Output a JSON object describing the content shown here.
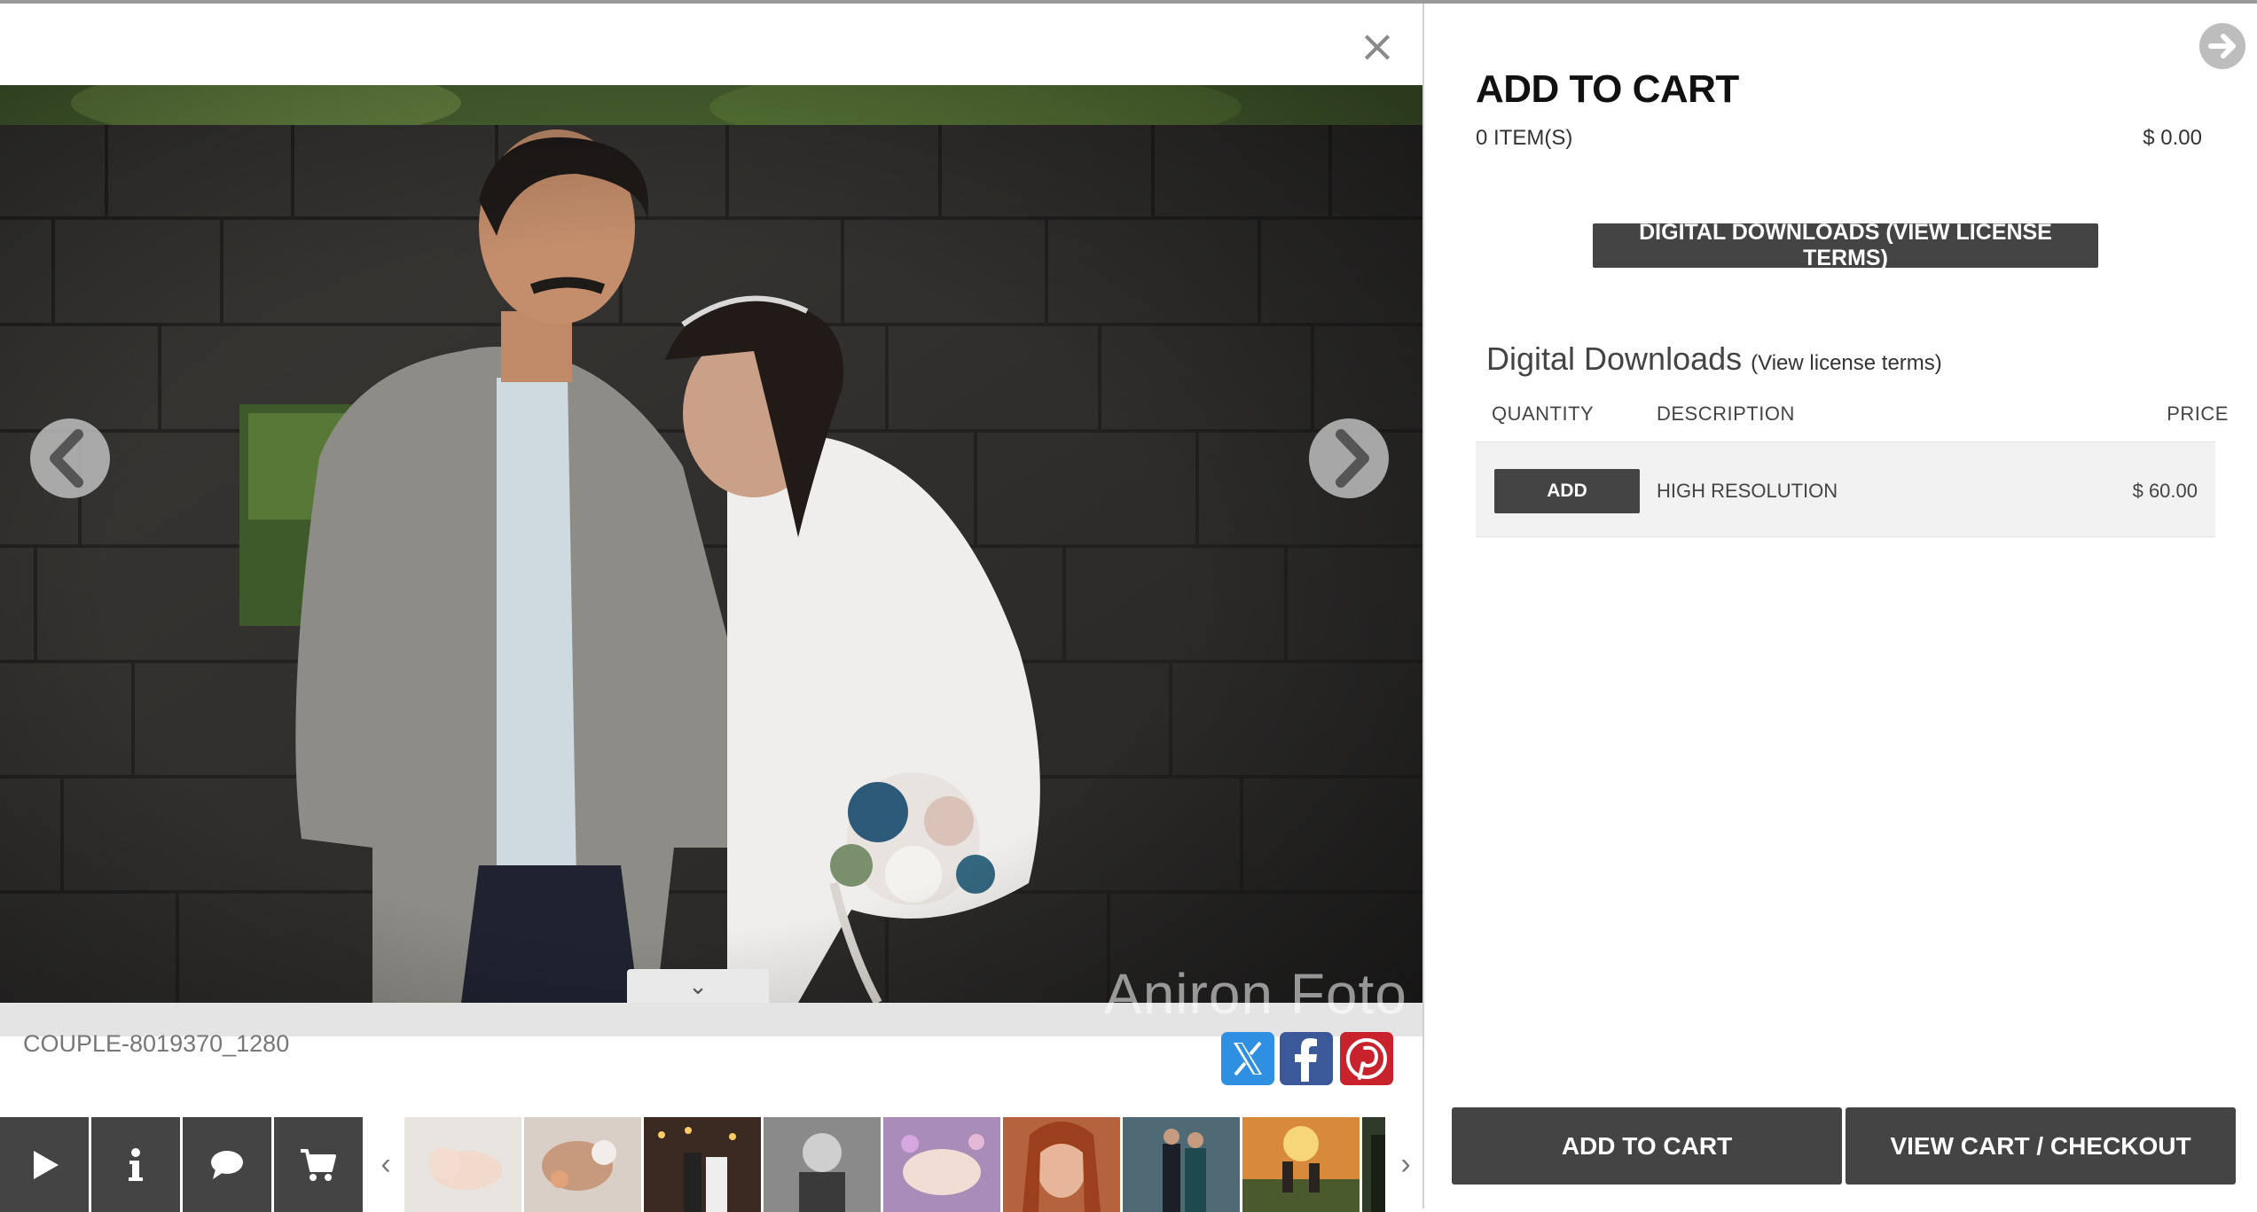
{
  "viewer": {
    "close_icon": "close-icon",
    "photo_name": "COUPLE-8019370_1280",
    "watermark": "Aniron Foto",
    "prev_icon": "chevron-left-icon",
    "next_icon": "chevron-right-icon",
    "collapse_icon": "chevron-down-icon",
    "share": [
      {
        "name": "x-share-button",
        "icon": "x-icon",
        "color": "#2f8fe0"
      },
      {
        "name": "facebook-share-button",
        "icon": "facebook-icon",
        "color": "#3b5998"
      },
      {
        "name": "pinterest-share-button",
        "icon": "pinterest-icon",
        "color": "#c8232c"
      }
    ],
    "toolbar": [
      {
        "name": "slideshow-button",
        "icon": "play-icon"
      },
      {
        "name": "info-button",
        "icon": "info-icon"
      },
      {
        "name": "comments-button",
        "icon": "comment-icon"
      },
      {
        "name": "cart-button",
        "icon": "cart-icon"
      }
    ],
    "thumbnails_count": 9
  },
  "cart": {
    "title": "ADD TO CART",
    "items_count": "0 ITEM(S)",
    "total": "$ 0.00",
    "go_icon": "arrow-right-circle-icon",
    "license_button": "DIGITAL DOWNLOADS (VIEW LICENSE TERMS)",
    "section_title": "Digital Downloads",
    "section_link": "(View license terms)",
    "columns": {
      "quantity": "QUANTITY",
      "description": "DESCRIPTION",
      "price": "PRICE"
    },
    "rows": [
      {
        "button": "ADD",
        "description": "HIGH RESOLUTION",
        "price": "$ 60.00"
      }
    ],
    "add_to_cart_button": "ADD TO CART",
    "checkout_button": "VIEW CART / CHECKOUT"
  },
  "colors": {
    "button_dark": "#444444",
    "panel_bg": "#ffffff",
    "row_bg": "#f2f2f2"
  }
}
